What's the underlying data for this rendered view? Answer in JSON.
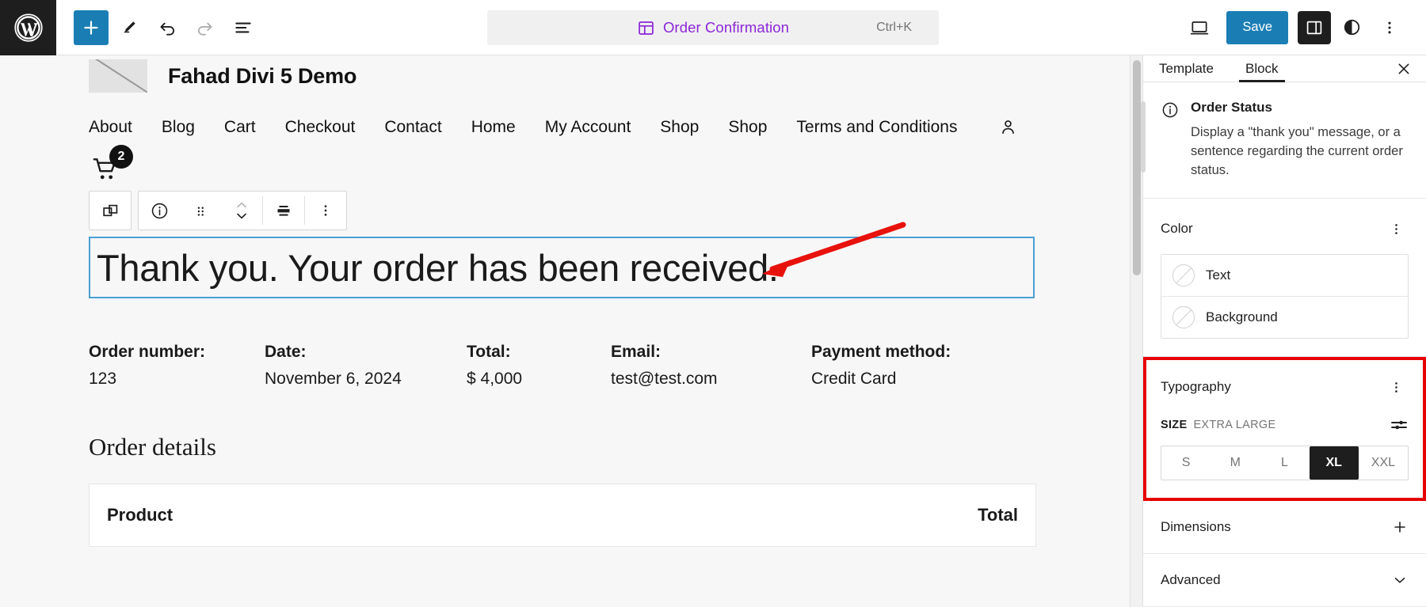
{
  "topbar": {
    "logo_icon": "wordpress-logo-icon",
    "left_tools": [
      {
        "name": "add-block-button",
        "icon": "plus-icon",
        "label": "Add block"
      },
      {
        "name": "edit-tool-button",
        "icon": "pencil-icon",
        "label": "Edit"
      },
      {
        "name": "undo-button",
        "icon": "undo-arrow-icon",
        "label": "Undo"
      },
      {
        "name": "redo-button",
        "icon": "redo-arrow-icon",
        "label": "Redo"
      },
      {
        "name": "list-view-button",
        "icon": "list-view-icon",
        "label": "Document Overview"
      }
    ],
    "document": {
      "icon": "template-layout-icon",
      "title": "Order Confirmation",
      "shortcut": "Ctrl+K"
    },
    "right_tools": [
      {
        "name": "view-device-button",
        "icon": "desktop-icon",
        "label": "View"
      },
      {
        "name": "save-button",
        "label": "Save"
      },
      {
        "name": "settings-sidebar-toggle",
        "icon": "sidebar-panel-icon",
        "label": "Settings"
      },
      {
        "name": "styles-button",
        "icon": "contrast-circle-icon",
        "label": "Styles"
      },
      {
        "name": "options-menu-button",
        "icon": "three-dots-vertical-icon",
        "label": "Options"
      }
    ]
  },
  "canvas": {
    "site_title": "Fahad Divi 5 Demo",
    "logo_placeholder": "broken-image-icon",
    "nav_items": [
      "About",
      "Blog",
      "Cart",
      "Checkout",
      "Contact",
      "Home",
      "My Account",
      "Shop",
      "Shop",
      "Terms and Conditions"
    ],
    "account_icon": "person-icon",
    "cart": {
      "icon": "shopping-cart-icon",
      "count": "2"
    },
    "block_toolbar": [
      {
        "name": "block-type-button",
        "icon": "copy-blocks-icon"
      },
      {
        "name": "block-info-button",
        "icon": "info-circle-icon"
      },
      {
        "name": "drag-handle",
        "icon": "drag-dots-icon"
      },
      {
        "name": "move-up-down-button",
        "icon": "chevron-up-down-icon"
      },
      {
        "name": "align-button",
        "icon": "align-center-icon"
      },
      {
        "name": "block-options-button",
        "icon": "three-dots-vertical-icon"
      }
    ],
    "order_status_text": "Thank you. Your order has been received.",
    "order_meta": [
      {
        "label": "Order number:",
        "value": "123"
      },
      {
        "label": "Date:",
        "value": "November 6, 2024"
      },
      {
        "label": "Total:",
        "value": "$ 4,000"
      },
      {
        "label": "Email:",
        "value": "test@test.com"
      },
      {
        "label": "Payment method:",
        "value": "Credit Card"
      }
    ],
    "order_details_heading": "Order details",
    "table_headers": {
      "product": "Product",
      "total": "Total"
    }
  },
  "sidebar": {
    "tabs": [
      {
        "name": "tab-template",
        "label": "Template",
        "active": false
      },
      {
        "name": "tab-block",
        "label": "Block",
        "active": true
      }
    ],
    "close_icon": "close-x-icon",
    "block_info": {
      "icon": "info-circle-icon",
      "title": "Order Status",
      "description": "Display a \"thank you\" message, or a sentence regarding the current order status."
    },
    "color": {
      "title": "Color",
      "menu_icon": "three-dots-vertical-icon",
      "rows": [
        {
          "name": "color-text-row",
          "label": "Text",
          "swatch": "no-color-icon"
        },
        {
          "name": "color-background-row",
          "label": "Background",
          "swatch": "no-color-icon"
        }
      ]
    },
    "typography": {
      "title": "Typography",
      "menu_icon": "three-dots-vertical-icon",
      "size_label": "SIZE",
      "size_value": "EXTRA LARGE",
      "settings_icon": "sliders-icon",
      "options": [
        "S",
        "M",
        "L",
        "XL",
        "XXL"
      ],
      "selected": "XL",
      "highlight_color": "#e60000"
    },
    "dimensions": {
      "title": "Dimensions",
      "icon": "plus-icon"
    },
    "advanced": {
      "title": "Advanced",
      "icon": "chevron-down-icon"
    }
  },
  "annotation": {
    "arrow_color": "#e8120c",
    "name": "red-pointer-arrow"
  }
}
